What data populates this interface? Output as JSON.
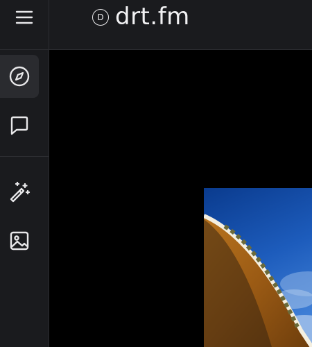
{
  "app": {
    "brand_letter": "D",
    "brand_name": "drt.fm"
  },
  "icons": {
    "menu": "menu-icon",
    "explore": "compass-icon",
    "chat": "chat-icon",
    "generate": "magic-wand-icon",
    "gallery": "image-icon"
  },
  "sidebar": {
    "active_item": "explore"
  },
  "colors": {
    "panel": "#1a1b1e",
    "active": "#2a2b2f",
    "border": "#2c2d31",
    "background": "#000000",
    "icon": "#e8e8ea"
  }
}
